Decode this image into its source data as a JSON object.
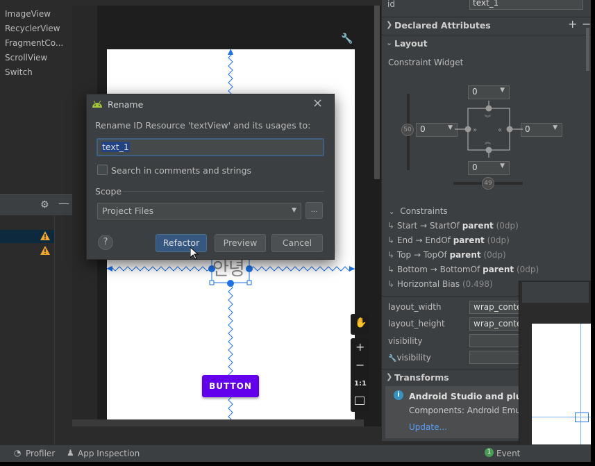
{
  "palette": {
    "items": [
      "ImageView",
      "RecyclerView",
      "FragmentCo...",
      "ScrollView",
      "Switch"
    ]
  },
  "design": {
    "button_label": "BUTTON",
    "textview_text": "안녕",
    "zoom_ratio_label": "1:1"
  },
  "dialog": {
    "title": "Rename",
    "prompt": "Rename ID Resource 'textView' and its usages to:",
    "new_name_value": "text_1",
    "search_comments_label": "Search in comments and strings",
    "search_comments_checked": false,
    "scope_label": "Scope",
    "scope_value": "Project Files",
    "browse_label": "...",
    "help_label": "?",
    "refactor_label": "Refactor",
    "preview_label": "Preview",
    "cancel_label": "Cancel"
  },
  "attributes": {
    "id_label": "id",
    "id_value": "text_1",
    "declared_title": "Declared Attributes",
    "add_label": "+",
    "remove_label": "−",
    "layout_title": "Layout",
    "constraint_widget_label": "Constraint Widget",
    "margins": {
      "top": "0",
      "left": "0",
      "right": "0",
      "bottom": "0"
    },
    "vertical_bias": "50",
    "horizontal_bias": "49",
    "constraints_title": "Constraints",
    "constraints": [
      {
        "from": "Start",
        "to": "StartOf",
        "target": "parent",
        "value": "(0dp)"
      },
      {
        "from": "End",
        "to": "EndOf",
        "target": "parent",
        "value": "(0dp)"
      },
      {
        "from": "Top",
        "to": "TopOf",
        "target": "parent",
        "value": "(0dp)"
      },
      {
        "from": "Bottom",
        "to": "BottomOf",
        "target": "parent",
        "value": "(0dp)"
      }
    ],
    "horizontal_bias_row": {
      "label": "Horizontal Bias",
      "value": "(0.498)"
    },
    "fields": [
      {
        "label": "layout_width",
        "value": "wrap_content"
      },
      {
        "label": "layout_height",
        "value": "wrap_content"
      },
      {
        "label": "visibility",
        "value": ""
      },
      {
        "label": "visibility",
        "value": ""
      }
    ],
    "transforms_title": "Transforms"
  },
  "notification": {
    "title": "Android Studio and plugin",
    "body": "Components: Android Emulat",
    "link": "Update..."
  },
  "bottombar": {
    "profiler": "Profiler",
    "app_inspection": "App Inspection",
    "event_count": "1",
    "event_label": "Event"
  },
  "colors": {
    "accent_blue": "#1a73e8",
    "button_purple": "#6200ee",
    "dialog_primary": "#365880",
    "warning_yellow": "#f0a732",
    "event_green": "#499c54"
  }
}
